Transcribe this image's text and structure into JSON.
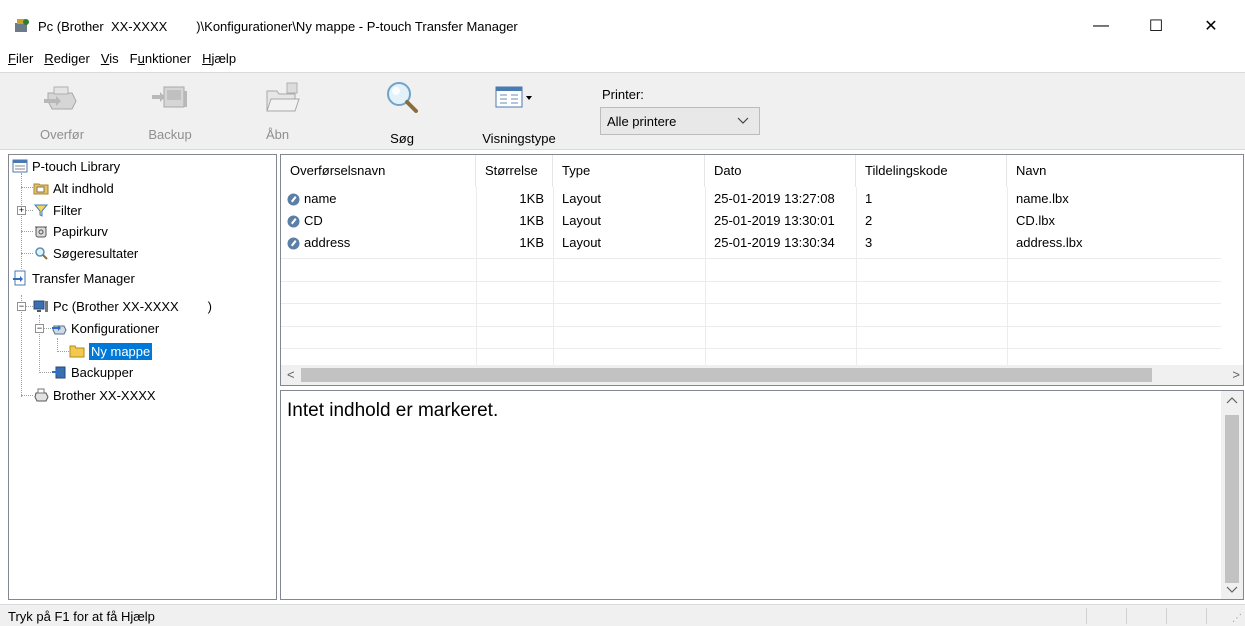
{
  "window": {
    "title": "Pc (Brother  XX-XXXX        )\\Konfigurationer\\Ny mappe - P-touch Transfer Manager",
    "minimize_glyph": "—",
    "maximize_glyph": "☐",
    "close_glyph": "✕"
  },
  "menu": {
    "items": [
      {
        "label": "Filer",
        "u": "F",
        "rest": "iler"
      },
      {
        "label": "Rediger",
        "u": "R",
        "rest": "ediger"
      },
      {
        "label": "Vis",
        "u": "V",
        "rest": "is"
      },
      {
        "label": "Funktioner",
        "pre": "F",
        "u": "u",
        "rest": "nktioner"
      },
      {
        "label": "Hjælp",
        "u": "H",
        "rest": "jælp"
      }
    ]
  },
  "toolbar": {
    "transfer_label": "Overfør",
    "backup_label": "Backup",
    "open_label": "Åbn",
    "search_label": "Søg",
    "viewtype_label": "Visningstype",
    "printer_label": "Printer:",
    "printer_value": "Alle printere"
  },
  "tree": {
    "library": "P-touch Library",
    "all_content": "Alt indhold",
    "filter": "Filter",
    "trash": "Papirkurv",
    "search_results": "Søgeresultater",
    "transfer_manager": "Transfer Manager",
    "pc": "Pc (Brother XX-XXXX        )",
    "configurations": "Konfigurationer",
    "new_folder": "Ny mappe",
    "backups": "Backupper",
    "brother": "Brother XX-XXXX"
  },
  "list": {
    "columns": [
      "Overførselsnavn",
      "Størrelse",
      "Type",
      "Dato",
      "Tildelingskode",
      "Navn"
    ],
    "rows": [
      {
        "name": "name",
        "size": "1KB",
        "type": "Layout",
        "date": "25-01-2019 13:27:08",
        "code": "1",
        "file": "name.lbx"
      },
      {
        "name": "CD",
        "size": "1KB",
        "type": "Layout",
        "date": "25-01-2019 13:30:01",
        "code": "2",
        "file": "CD.lbx"
      },
      {
        "name": "address",
        "size": "1KB",
        "type": "Layout",
        "date": "25-01-2019 13:30:34",
        "code": "3",
        "file": "address.lbx"
      }
    ]
  },
  "preview": {
    "empty_text": "Intet indhold er markeret."
  },
  "status": {
    "text": "Tryk på F1 for at få Hjælp"
  },
  "icons": {
    "app": "p-touch-app-icon",
    "transfer": "transfer-printer-icon",
    "backup": "backup-printer-icon",
    "open": "open-folder-icon",
    "search": "magnifier-icon",
    "viewtype": "view-list-icon"
  },
  "colors": {
    "selection": "#0078d7",
    "toolbar_bg": "#f0f0f0"
  }
}
